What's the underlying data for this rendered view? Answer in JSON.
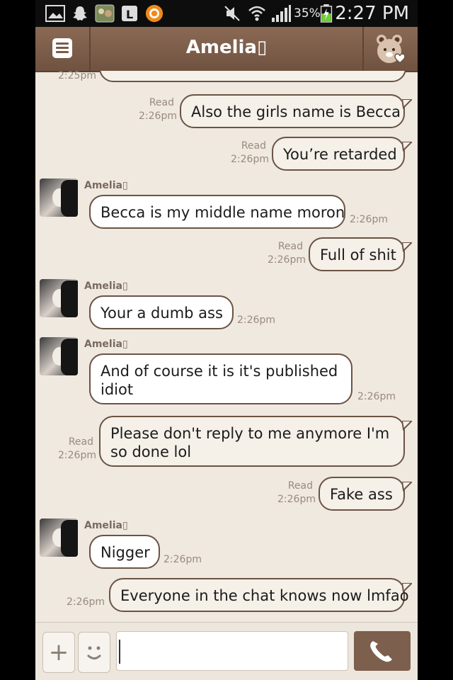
{
  "status_bar": {
    "battery_percent": "35%",
    "time": "2:27 PM"
  },
  "header": {
    "title": "Amelia▯"
  },
  "messages": [
    {
      "id": "m1",
      "sender": "me",
      "text": "Also the girls name is Becca",
      "read": "Read",
      "time": "2:26pm"
    },
    {
      "id": "m2",
      "sender": "me",
      "text": "You’re retarded",
      "read": "Read",
      "time": "2:26pm"
    },
    {
      "id": "m3",
      "sender": "Amelia▯",
      "text": "Becca is my middle name moron",
      "time": "2:26pm"
    },
    {
      "id": "m4",
      "sender": "me",
      "text": "Full of shit",
      "read": "Read",
      "time": "2:26pm"
    },
    {
      "id": "m5",
      "sender": "Amelia▯",
      "text": "Your a dumb ass",
      "time": "2:26pm"
    },
    {
      "id": "m6",
      "sender": "Amelia▯",
      "text": "And of course it is it's published idiot",
      "time": "2:26pm"
    },
    {
      "id": "m7",
      "sender": "me",
      "text": "Please don't reply to me anymore I'm so done lol",
      "read": "Read",
      "time": "2:26pm"
    },
    {
      "id": "m8",
      "sender": "me",
      "text": "Fake ass",
      "read": "Read",
      "time": "2:26pm"
    },
    {
      "id": "m9",
      "sender": "Amelia▯",
      "text": "Nigger",
      "time": "2:26pm"
    },
    {
      "id": "m10",
      "sender": "me",
      "text": "Everyone in the chat knows now lmfao",
      "time": "2:26pm"
    }
  ],
  "partial_top": {
    "time": "2:25pm"
  },
  "input": {
    "placeholder": "",
    "value": ""
  },
  "icons": {
    "menu": "menu-icon",
    "bear": "bear-heart-icon",
    "plus": "plus-icon",
    "emoji": "smiley-icon",
    "call": "phone-icon"
  },
  "colors": {
    "header": "#7a5b48",
    "background": "#efe9e0",
    "bubble_border": "#6b5344",
    "meta": "#9a8a7e"
  }
}
